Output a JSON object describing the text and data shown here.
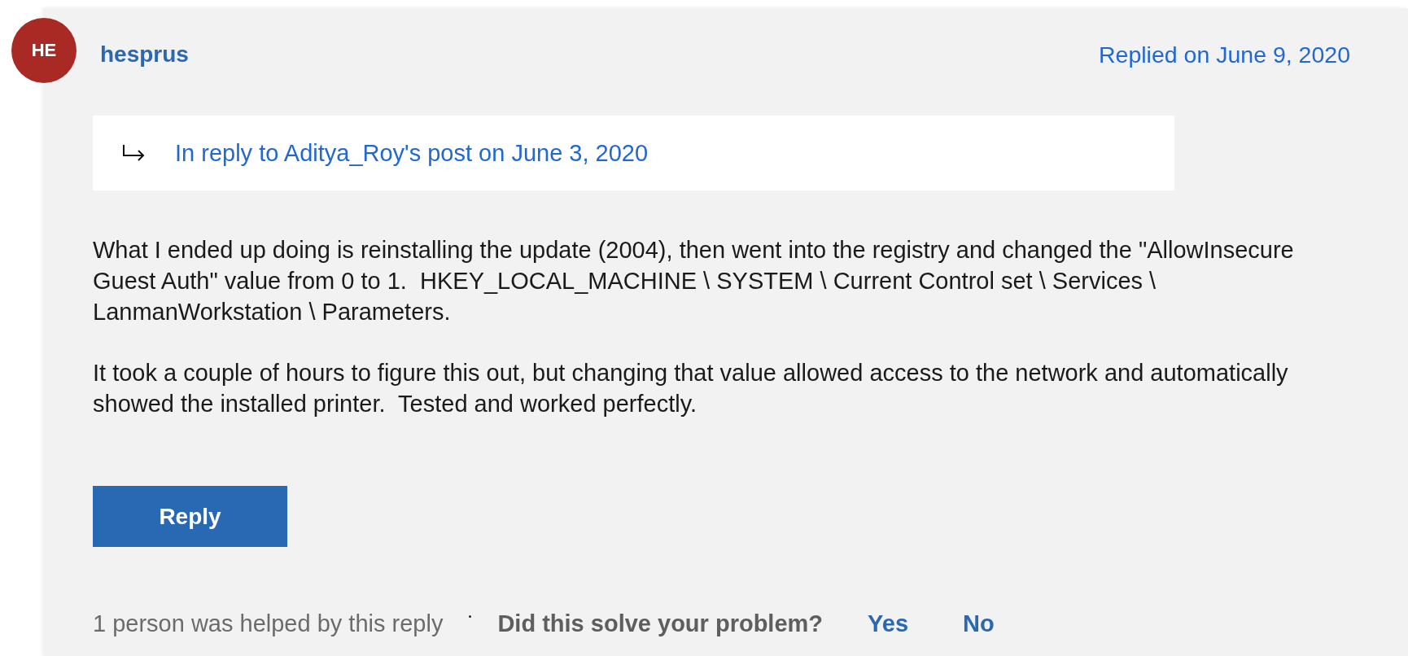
{
  "post": {
    "avatar": {
      "initials": "HE"
    },
    "author": "hesprus",
    "date": "Replied on June 9, 2020",
    "in_reply_to": "In reply to Aditya_Roy's post on June 3, 2020",
    "body": [
      "What I ended up doing is reinstalling the update (2004), then went into the registry and changed the \"AllowInsecure Guest Auth\" value from 0 to 1.  HKEY_LOCAL_MACHINE \\ SYSTEM \\ Current Control set \\ Services \\ LanmanWorkstation \\ Parameters.",
      "It took a couple of hours to figure this out, but changing that value allowed access to the network and automatically showed the installed printer.  Tested and worked perfectly."
    ],
    "reply_button": "Reply"
  },
  "footer": {
    "helped": "1 person was helped by this reply",
    "question": "Did this solve your problem?",
    "answers": [
      "Yes",
      "No"
    ]
  }
}
